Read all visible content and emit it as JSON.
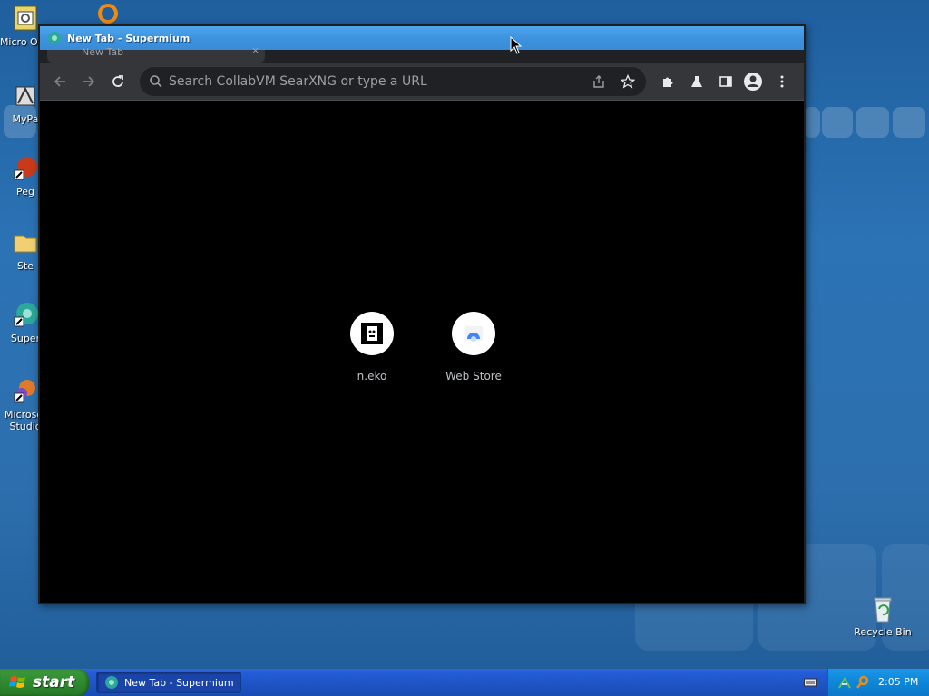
{
  "desktop": {
    "icons": [
      {
        "label": "Micro Outl",
        "icon": "outlook-icon"
      },
      {
        "label": "MyPa",
        "icon": "mypal-icon"
      },
      {
        "label": "Peg",
        "icon": "pegasus-icon"
      },
      {
        "label": "Ste",
        "icon": "folder-icon"
      },
      {
        "label": "Super",
        "icon": "supermium-icon"
      },
      {
        "label": "Microsof Studio",
        "icon": "visual-studio-icon"
      }
    ],
    "recycle_bin": "Recycle Bin"
  },
  "window": {
    "title": "New Tab - Supermium",
    "tab_title": "New Tab"
  },
  "toolbar": {
    "omnibox_placeholder": "Search CollabVM SearXNG or type a URL"
  },
  "shortcuts": [
    {
      "label": "n.eko",
      "icon": "neko-icon"
    },
    {
      "label": "Web Store",
      "icon": "web-store-icon"
    }
  ],
  "taskbar": {
    "start_label": "start",
    "task_label": "New Tab - Supermium",
    "clock": "2:05 PM"
  },
  "colors": {
    "desktop_bg": "#2b73b5",
    "titlebar": "#3d93df",
    "browser_toolbar": "#35363a",
    "page_bg": "#000000",
    "taskbar": "#245edb",
    "start_button": "#2f8a2f"
  }
}
